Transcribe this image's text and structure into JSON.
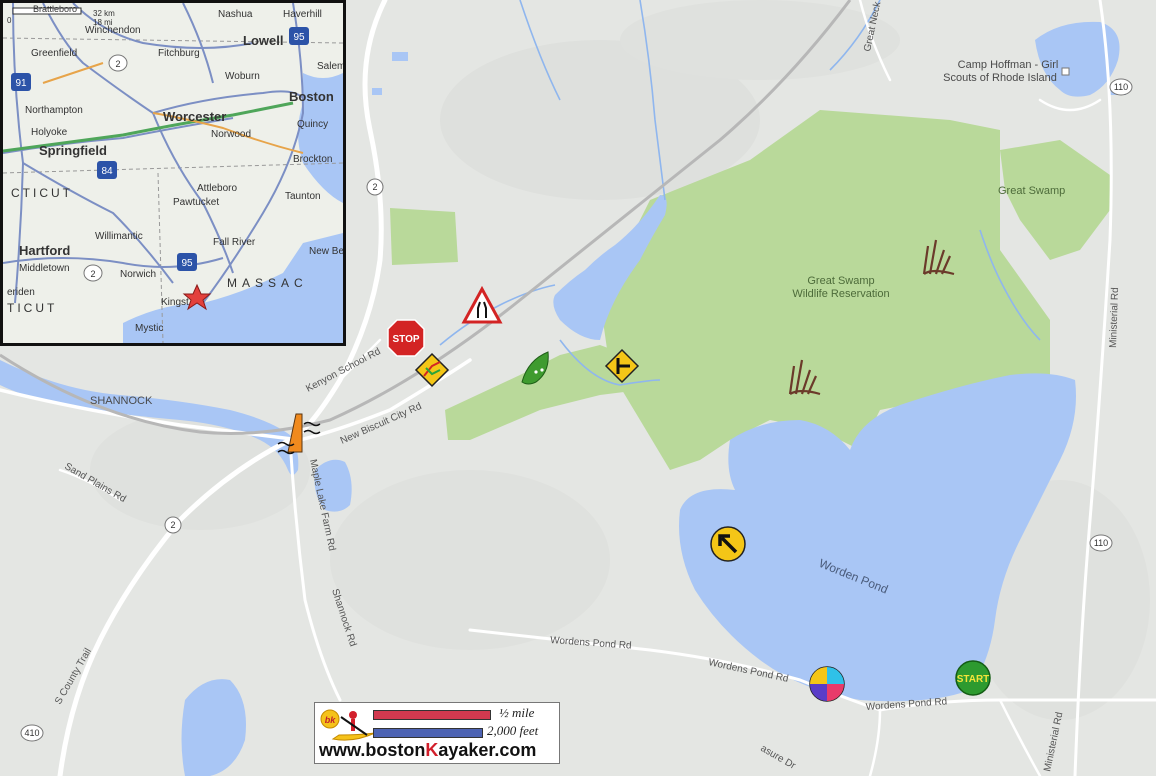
{
  "map": {
    "labels": {
      "camp": [
        "Camp Hoffman - Girl",
        "Scouts of Rhode Island"
      ],
      "great_swamp": "Great Swamp",
      "reservation": [
        "Great Swamp",
        "Wildlife Reservation"
      ],
      "worden_pond": "Worden Pond",
      "shannock": "SHANNOCK",
      "kenyon_school_rd": "Kenyon School Rd",
      "new_biscuit_city_rd": "New Biscuit City Rd",
      "maple_lake_farm_rd": "Maple Lake Farm Rd",
      "shannock_rd": "Shannock Rd",
      "sand_plains_rd": "Sand Plains Rd",
      "s_county_trail": "S County Trail",
      "wordens_pond_rd_1": "Wordens Pond Rd",
      "wordens_pond_rd_2": "Wordens Pond Rd",
      "wordens_pond_rd_3": "Wordens Pond Rd",
      "ministerial_rd_1": "Ministerial Rd",
      "ministerial_rd_2": "Ministerial Rd",
      "great_neck_rd": "Great Neck R",
      "pleasure_dr": "asure Dr"
    },
    "shields": {
      "r110_top": "110",
      "r110_mid": "110",
      "r2_top": "2",
      "r2_low": "2",
      "r410": "410"
    },
    "markers": {
      "stop": "STOP",
      "start": "START"
    },
    "colors": {
      "water": "#a9c6f5",
      "park": "#b9d99a",
      "land": "#e4e6e3",
      "road": "#ffffff"
    }
  },
  "inset": {
    "scale": {
      "km": "32 km",
      "mi": "18 mi",
      "zero": "0"
    },
    "cities": {
      "brattleboro": "Brattleboro",
      "nashua": "Nashua",
      "haverhill": "Haverhill",
      "winchendon": "Winchendon",
      "lowell": "Lowell",
      "greenfield": "Greenfield",
      "fitchburg": "Fitchburg",
      "woburn": "Woburn",
      "salem": "Salem",
      "boston": "Boston",
      "northampton": "Northampton",
      "worcester": "Worcester",
      "holyoke": "Holyoke",
      "norwood": "Norwood",
      "quincy": "Quincy",
      "springfield": "Springfield",
      "brockton": "Brockton",
      "attleboro": "Attleboro",
      "pawtucket": "Pawtucket",
      "taunton": "Taunton",
      "willimantic": "Willimantic",
      "fall_river": "Fall River",
      "new_b": "New Be",
      "hartford": "Hartford",
      "middletown": "Middletown",
      "norwich": "Norwich",
      "meriden": "eriden",
      "kingston": "Kingst",
      "mystic": "Mystic",
      "cticut_1": "CTICUT",
      "cticut_2": "TICUT",
      "massac": "MASSAC"
    },
    "shields": {
      "i95_top": "95",
      "i91": "91",
      "r2": "2",
      "i84": "84",
      "i95_low": "95",
      "r2_low": "2"
    }
  },
  "legend": {
    "half_mile": "½ mile",
    "feet": "2,000 feet",
    "url_prefix": "www.boston",
    "url_k": "K",
    "url_suffix": "ayaker.com",
    "logo": "bk"
  }
}
